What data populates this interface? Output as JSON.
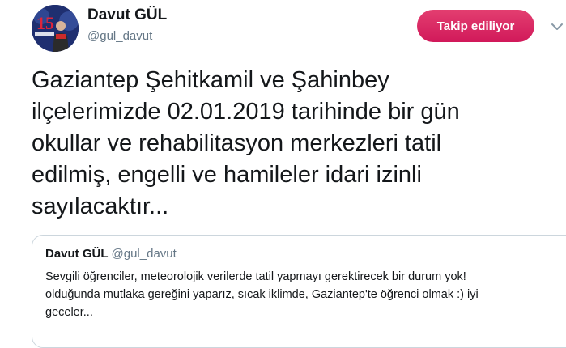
{
  "author": {
    "name": "Davut GÜL",
    "handle": "@gul_davut",
    "avatar_icon": "profile-photo"
  },
  "follow_button": {
    "label": "Takip ediliyor",
    "color": "#e0245e"
  },
  "menu": {
    "icon": "chevron-down-icon"
  },
  "tweet": {
    "lines": [
      "Gaziantep Şehitkamil ve Şahinbey",
      "ilçelerimizde 02.01.2019 tarihinde bir gün",
      "okullar ve rehabilitasyon merkezleri tatil",
      "edilmiş, engelli ve hamileler idari izinli",
      "sayılacaktır..."
    ]
  },
  "quote": {
    "name": "Davut GÜL",
    "handle": "@gul_davut",
    "lines": [
      "Sevgili öğrenciler, meteorolojik verilerde tatil yapmayı gerektirecek bir durum yok!",
      "olduğunda mutlaka gereğini yaparız, sıcak iklimde, Gaziantep'te öğrenci olmak :) iyi",
      "geceler..."
    ]
  }
}
